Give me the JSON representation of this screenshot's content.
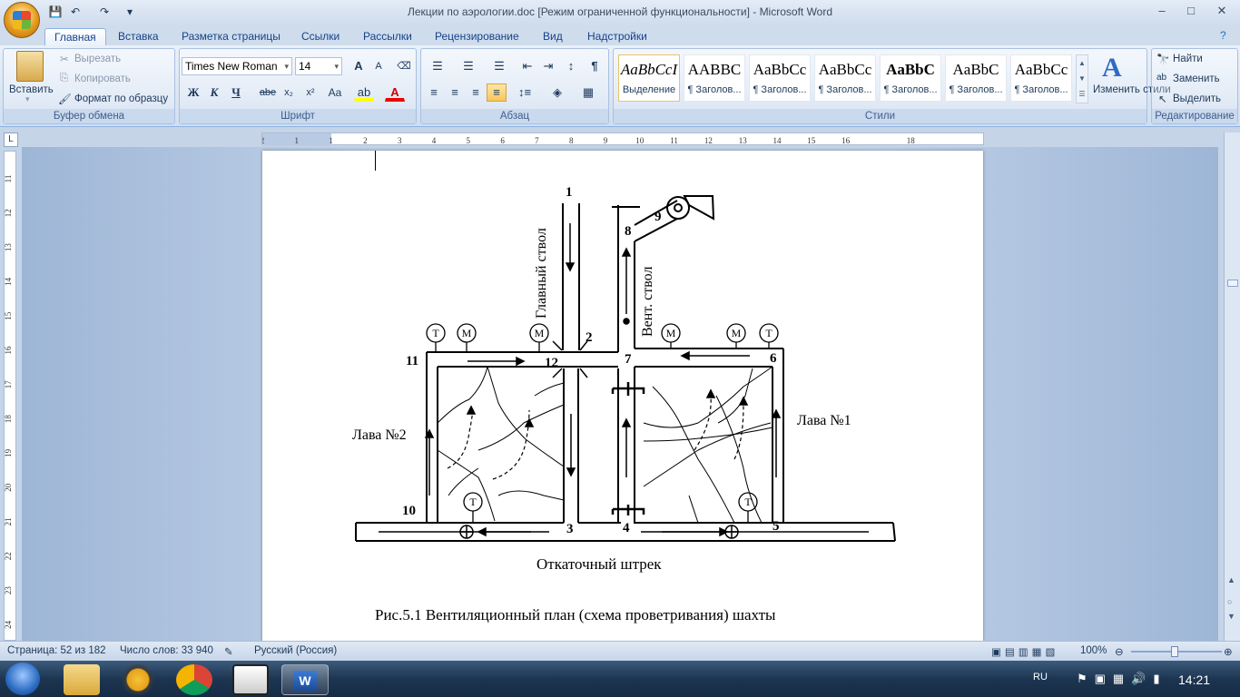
{
  "window": {
    "title": "Лекции по аэрологии.doc [Режим ограниченной функциональности] - Microsoft Word",
    "minimize": "–",
    "maximize": "□",
    "close": "✕"
  },
  "qat": {
    "save": "💾",
    "undo": "↶",
    "redo": "↷",
    "more": "▾"
  },
  "tabs": [
    "Главная",
    "Вставка",
    "Разметка страницы",
    "Ссылки",
    "Рассылки",
    "Рецензирование",
    "Вид",
    "Надстройки"
  ],
  "clipboard": {
    "paste": "Вставить",
    "cut": "Вырезать",
    "copy": "Копировать",
    "format_painter": "Формат по образцу",
    "label": "Буфер обмена"
  },
  "font": {
    "name": "Times New Roman",
    "size": "14",
    "label": "Шрифт",
    "bold": "Ж",
    "italic": "К",
    "underline": "Ч",
    "strike": "abe",
    "subscript": "x₂",
    "superscript": "x²",
    "case": "Aa",
    "grow": "A",
    "shrink": "A"
  },
  "paragraph": {
    "label": "Абзац",
    "pilcrow": "¶"
  },
  "styles": {
    "label": "Стили",
    "items": [
      {
        "sample": "AaBbCcI",
        "name": "Выделение"
      },
      {
        "sample": "AABBC",
        "name": "¶ Заголов..."
      },
      {
        "sample": "AaBbCc",
        "name": "¶ Заголов..."
      },
      {
        "sample": "AaBbCc",
        "name": "¶ Заголов..."
      },
      {
        "sample": "AaBbC",
        "name": "¶ Заголов..."
      },
      {
        "sample": "AaBbC",
        "name": "¶ Заголов..."
      },
      {
        "sample": "AaBbCc",
        "name": "¶ Заголов..."
      }
    ],
    "change": "Изменить стили"
  },
  "editing": {
    "label": "Редактирование",
    "find": "Найти",
    "replace": "Заменить",
    "select": "Выделить"
  },
  "ruler": {
    "h_ticks": [
      "2",
      "1",
      "1",
      "2",
      "3",
      "4",
      "5",
      "6",
      "7",
      "8",
      "9",
      "10",
      "11",
      "12",
      "13",
      "14",
      "15",
      "16",
      "18"
    ],
    "v_ticks": [
      "11",
      "12",
      "13",
      "14",
      "15",
      "16",
      "17",
      "18",
      "19",
      "20",
      "21",
      "22",
      "23",
      "24"
    ]
  },
  "diagram": {
    "nodes": [
      "1",
      "2",
      "3",
      "4",
      "5",
      "6",
      "7",
      "8",
      "9",
      "10",
      "11",
      "12"
    ],
    "main_shaft": "Главный ствол",
    "vent_shaft": "Вент. ствол",
    "lava2": "Лава №2",
    "lava1": "Лава №1",
    "haulage": "Откаточный штрек",
    "sensor_t": "Т",
    "sensor_m": "М",
    "caption": "Рис.5.1 Вентиляционный план (схема проветривания) шахты"
  },
  "status": {
    "page": "Страница: 52 из 182",
    "words": "Число слов: 33 940",
    "language": "Русский (Россия)",
    "zoom": "100%"
  },
  "taskbar": {
    "lang": "RU",
    "time": "14:21"
  }
}
